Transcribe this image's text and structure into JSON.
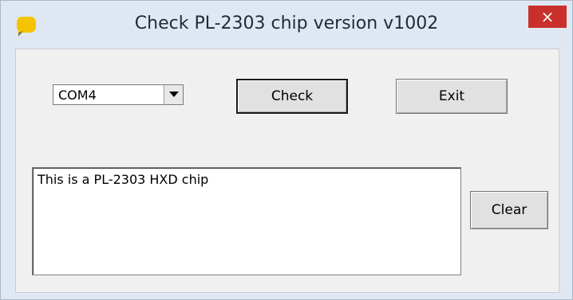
{
  "window": {
    "title": "Check PL-2303 chip version v1002",
    "close_label": "×",
    "icon": "app-yellow-icon"
  },
  "port": {
    "selected": "COM4",
    "icon": "chevron-down-icon"
  },
  "buttons": {
    "check": "Check",
    "exit": "Exit",
    "clear": "Clear"
  },
  "output": {
    "text": "This is a PL-2303 HXD chip"
  },
  "colors": {
    "close": "#c9302c",
    "title_bar": "#dfe8f2",
    "client": "#f0f0f0"
  }
}
